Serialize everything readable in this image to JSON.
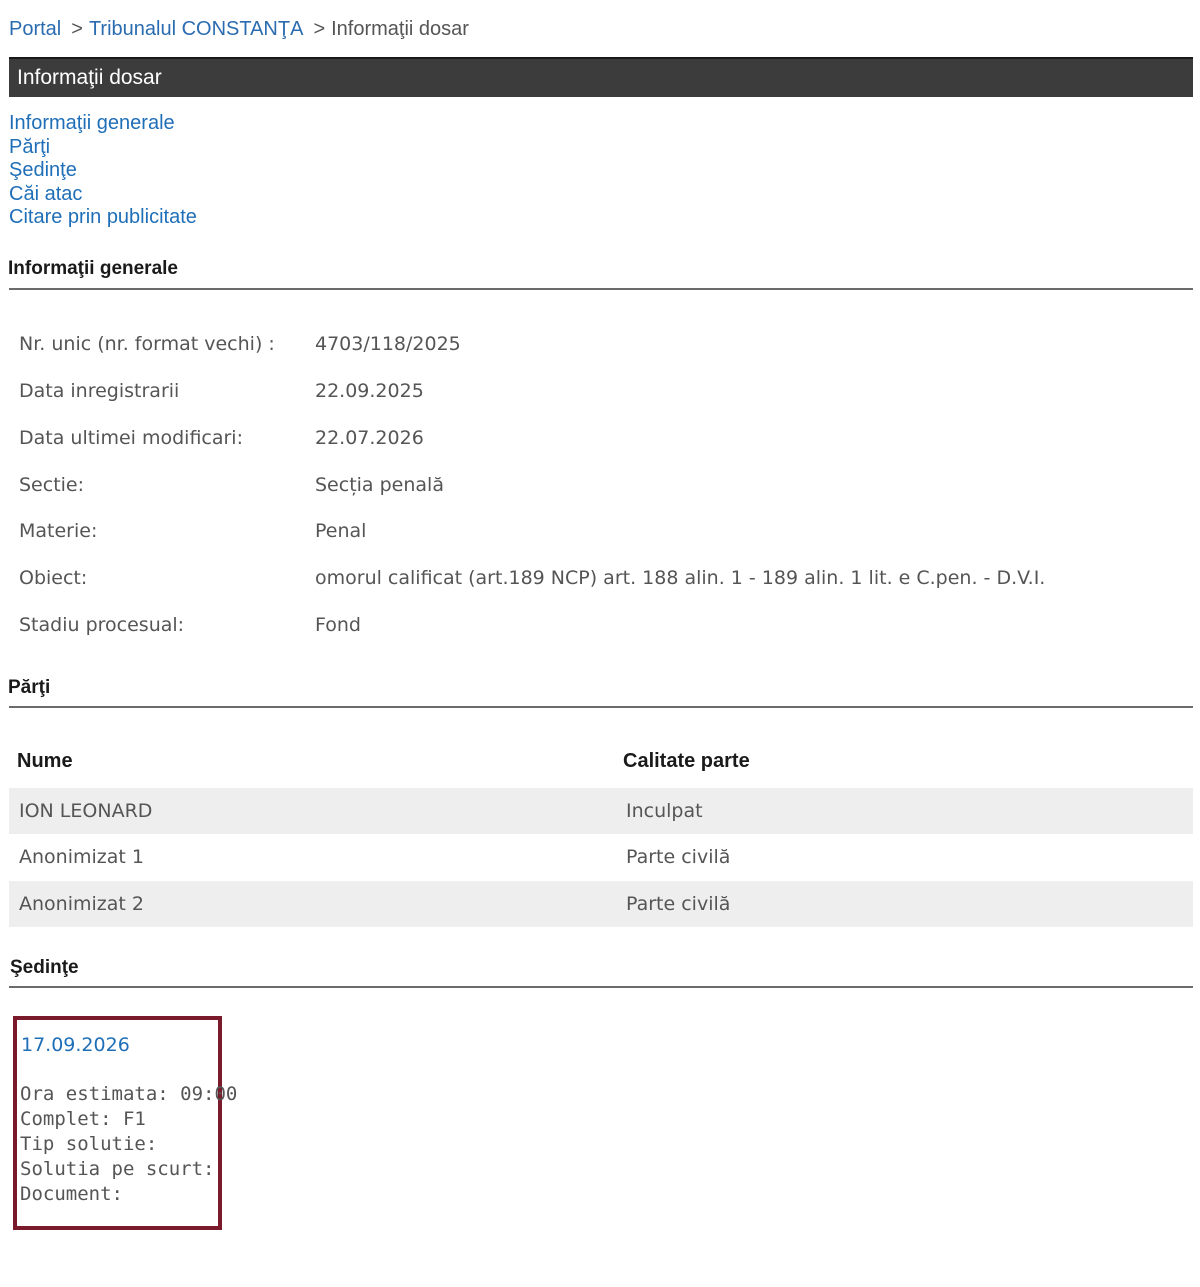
{
  "breadcrumb": {
    "portal": "Portal",
    "court": "Tribunalul CONSTANŢA",
    "current": "Informaţii dosar",
    "sep": ">"
  },
  "title_bar": "Informaţii dosar",
  "nav": {
    "items": [
      "Informaţii generale",
      "Părţi",
      "Şedinţe",
      "Căi atac",
      "Citare prin publicitate"
    ]
  },
  "general": {
    "heading": "Informaţii generale",
    "rows": [
      {
        "label": "Nr. unic (nr. format vechi) :",
        "value": "4703/118/2025"
      },
      {
        "label": "Data inregistrarii",
        "value": "22.09.2025"
      },
      {
        "label": "Data ultimei modificari:",
        "value": "22.07.2026"
      },
      {
        "label": "Sectie:",
        "value": "Secția penală"
      },
      {
        "label": "Materie:",
        "value": "Penal"
      },
      {
        "label": "Obiect:",
        "value": "omorul calificat (art.189 NCP) art. 188 alin. 1 - 189 alin. 1 lit. e C.pen. - D.V.I."
      },
      {
        "label": "Stadiu procesual:",
        "value": "Fond"
      }
    ]
  },
  "parties": {
    "heading": "Părţi",
    "columns": [
      "Nume",
      "Calitate parte"
    ],
    "rows": [
      {
        "name": "ION LEONARD",
        "role": "Inculpat"
      },
      {
        "name": "Anonimizat 1",
        "role": "Parte civilă"
      },
      {
        "name": "Anonimizat 2",
        "role": "Parte civilă"
      }
    ]
  },
  "sessions": {
    "heading": "Şedinţe",
    "date": "17.09.2026",
    "lines": [
      "Ora estimata: 09:00",
      "Complet: F1",
      "Tip solutie:",
      "Solutia pe scurt:",
      "Document:"
    ],
    "highlight_color": "#7a1a2a"
  }
}
